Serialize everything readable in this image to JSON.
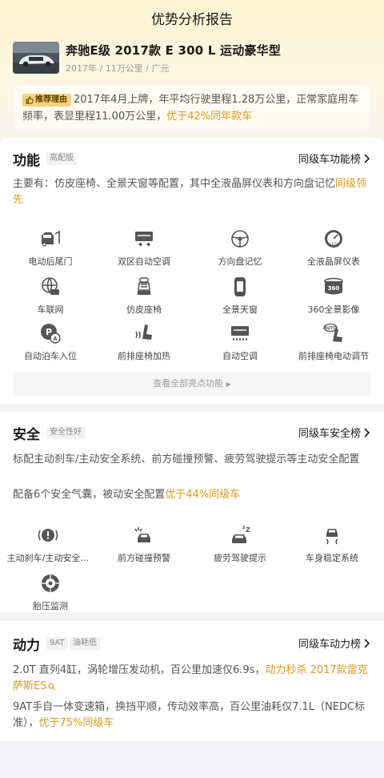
{
  "header": {
    "title": "优势分析报告"
  },
  "car": {
    "name": "奔驰E级 2017款 E 300 L 运动豪华型",
    "meta": "2017年 / 11万公里 / 广元"
  },
  "reason": {
    "badge": "推荐理由",
    "text_a": "2017年4月上牌，年平均行驶里程1.28万公里，正常家庭用车频率，表显里程11.00万公里，",
    "text_hl": "优于42%同年款车"
  },
  "features": {
    "title": "功能",
    "tag": "高配版",
    "rank_link": "同级车功能榜",
    "desc_a": "主要有：仿皮座椅、全景天窗等配置，其中全液晶屏仪表和方向盘记忆",
    "desc_hl": "同级领先",
    "items": [
      {
        "label": "电动后尾门",
        "icon": "power-tailgate-icon"
      },
      {
        "label": "双区自动空调",
        "icon": "dual-zone-ac-icon"
      },
      {
        "label": "方向盘记忆",
        "icon": "steering-memory-icon"
      },
      {
        "label": "全液晶屏仪表",
        "icon": "lcd-gauge-icon"
      },
      {
        "label": "车联网",
        "icon": "connected-car-icon"
      },
      {
        "label": "仿皮座椅",
        "icon": "leatherette-seat-icon"
      },
      {
        "label": "全景天窗",
        "icon": "panoramic-sunroof-icon"
      },
      {
        "label": "360全景影像",
        "icon": "camera-360-icon"
      },
      {
        "label": "自动泊车入位",
        "icon": "auto-parking-icon"
      },
      {
        "label": "前排座椅加热",
        "icon": "seat-heating-icon"
      },
      {
        "label": "自动空调",
        "icon": "auto-ac-icon"
      },
      {
        "label": "前排座椅电动调节",
        "icon": "seat-electric-adjust-icon"
      }
    ],
    "more_label": "查看全部亮点功能"
  },
  "safety": {
    "title": "安全",
    "tag": "安全性好",
    "rank_link": "同级车安全榜",
    "desc1": "标配主动刹车/主动安全系统、前方碰撞预警、疲劳驾驶提示等主动安全配置",
    "desc2_a": "配备6个安全气囊，被动安全配置",
    "desc2_hl": "优于44%同级车",
    "items": [
      {
        "label": "主动刹车/主动安全…",
        "icon": "active-brake-icon"
      },
      {
        "label": "前方碰撞预警",
        "icon": "collision-warning-icon"
      },
      {
        "label": "疲劳驾驶提示",
        "icon": "fatigue-alert-icon"
      },
      {
        "label": "车身稳定系统",
        "icon": "stability-control-icon"
      },
      {
        "label": "胎压监测",
        "icon": "tire-pressure-icon"
      }
    ]
  },
  "power": {
    "title": "动力",
    "tag1": "9AT",
    "tag2": "油耗低",
    "rank_link": "同级车动力榜",
    "desc1_a": "2.0T 直列4缸，涡轮增压发动机，百公里加速仅6.9s，",
    "desc1_hl": "动力秒杀 2017款雷克萨斯ES",
    "desc2_a": "9AT手自一体变速箱，换挡平顺，传动效率高，百公里油耗仅7.1L（NEDC标准），",
    "desc2_hl": "优于75%同级车"
  },
  "colors": {
    "accent": "#d99a1e",
    "badge": "#f7d27a"
  }
}
